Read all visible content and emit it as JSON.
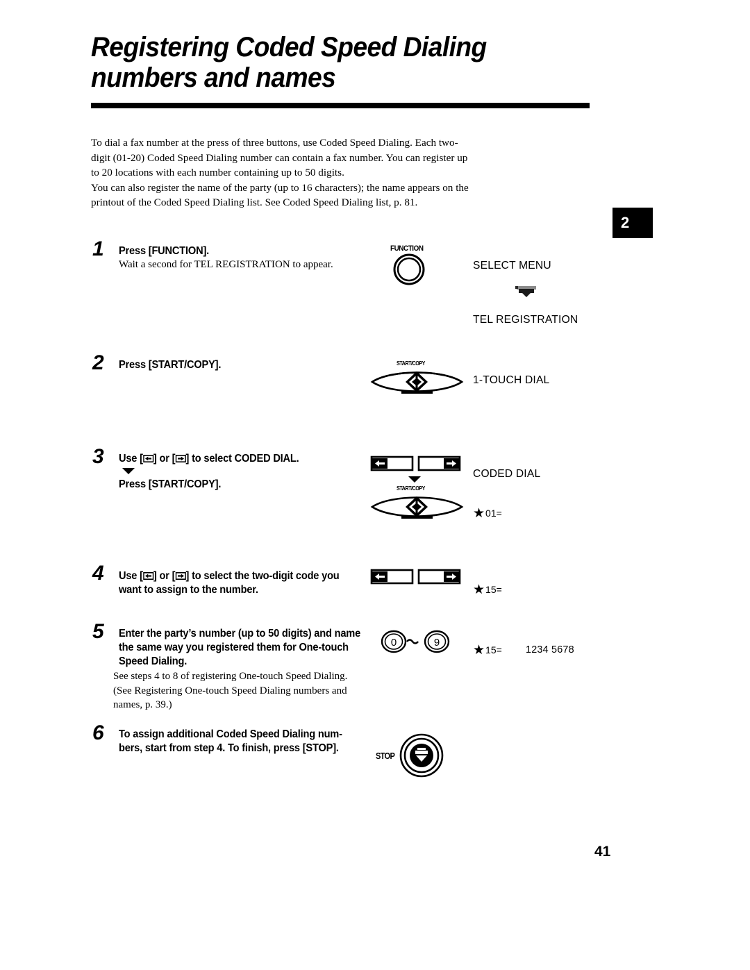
{
  "document": {
    "title_lines": [
      "Registering Coded Speed Dialing",
      "numbers and names"
    ],
    "chapter_tab": "2",
    "page_number": "41"
  },
  "intro": {
    "paragraph_1": "To dial a fax number at the press of three buttons, use Coded Speed Dialing. Each two-digit (01-20) Coded Speed Dialing number can contain a fax number. You can register up to 20 locations with each number containing up to 50 digits.",
    "paragraph_2": "You can also register the name of the party (up to 16 characters); the name appears on the printout of the Coded Speed Dialing list. See Coded Speed Dialing list, p. 81."
  },
  "steps": [
    {
      "number": "1",
      "heading": "Press [FUNCTION].",
      "sub": "Wait a second for TEL REGISTRATION to appear.",
      "button_label": "FUNCTION"
    },
    {
      "number": "2",
      "heading": "Press [START/COPY].",
      "button_label": "START/COPY"
    },
    {
      "number": "3",
      "heading_prefix": "Use [",
      "heading_mid": "] or [",
      "heading_suffix": "] to select CODED DIAL.",
      "heading_2": "Press [START/COPY].",
      "button_label": "START/COPY"
    },
    {
      "number": "4",
      "heading_prefix": "Use [",
      "heading_mid": "] or [",
      "heading_suffix": "] to select the two-digit code you",
      "heading_line2": "want to assign to the number."
    },
    {
      "number": "5",
      "heading_line1": "Enter the party’s number (up to 50 digits) and name",
      "heading_line2": "the same way you registered them for One-touch",
      "heading_line3": "Speed Dialing.",
      "sub": "See steps 4 to 8 of registering One-touch Speed Dialing. (See Registering One-touch Speed Dialing numbers and names, p. 39.)",
      "key_low": "0",
      "key_high": "9"
    },
    {
      "number": "6",
      "heading_line1": "To assign additional Coded Speed Dialing num-",
      "heading_line2": "bers, start from step 4. To finish, press [STOP].",
      "button_label": "STOP"
    }
  ],
  "display": {
    "select_menu": "SELECT MENU",
    "tel_registration": "TEL REGISTRATION",
    "one_touch_dial": "1-TOUCH DIAL",
    "coded_dial": "CODED DIAL",
    "code_01": "01=",
    "code_15_a": "15=",
    "code_15_b": "15=",
    "number_entered": "1234 5678",
    "star_symbol": "★"
  }
}
